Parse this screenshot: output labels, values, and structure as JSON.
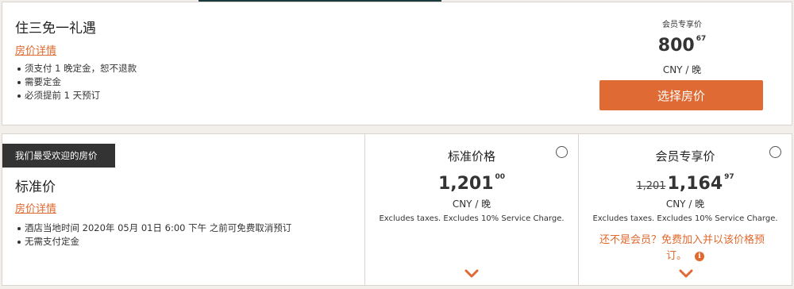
{
  "rate1": {
    "title": "住三免一礼遇",
    "details_link": "房价详情",
    "conditions": [
      "须支付 1 晚定金，恕不退款",
      "需要定金",
      "必须提前 1 天预订"
    ],
    "member_label": "会员专享价",
    "price_main": "800",
    "price_cents": "67",
    "per_night": "CNY / 晚",
    "select_button": "选择房价"
  },
  "rate2": {
    "badge": "我们最受欢迎的房价",
    "title": "标准价",
    "details_link": "房价详情",
    "conditions": [
      "酒店当地时间 2020年 05月 01日 6:00 下午 之前可免费取消预订",
      "无需支付定金"
    ],
    "standard": {
      "heading": "标准价格",
      "price_main": "1,201",
      "price_cents": "00",
      "per_night": "CNY / 晚",
      "excludes": "Excludes taxes. Excludes 10% Service Charge."
    },
    "member": {
      "heading": "会员专享价",
      "original_price": "1,201",
      "price_main": "1,164",
      "price_cents": "97",
      "excludes": "Excludes taxes. Excludes 10% Service Charge.",
      "join_line1": "还不是会员？免费加入并以该价格预",
      "join_line2": "订。"
    }
  },
  "colors": {
    "accent": "#df6a33",
    "badge_bg": "#333333",
    "page_bg": "#f2efea"
  },
  "icons": {
    "info": "info-icon",
    "expand": "chevron-down-icon",
    "radio": "radio-button"
  }
}
